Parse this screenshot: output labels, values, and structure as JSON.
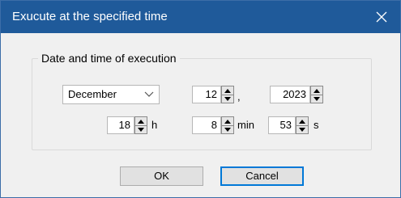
{
  "window": {
    "title": "Exucute at the specified time"
  },
  "group": {
    "legend": "Date and time of execution"
  },
  "month": {
    "value": "December"
  },
  "day": {
    "value": "12"
  },
  "year": {
    "value": "2023"
  },
  "comma": ",",
  "hour": {
    "value": "18",
    "unit": "h"
  },
  "minute": {
    "value": "8",
    "unit": "min"
  },
  "second": {
    "value": "53",
    "unit": "s"
  },
  "buttons": {
    "ok": "OK",
    "cancel": "Cancel"
  },
  "colors": {
    "titlebar": "#1f5a9a",
    "accent": "#0078d7"
  }
}
